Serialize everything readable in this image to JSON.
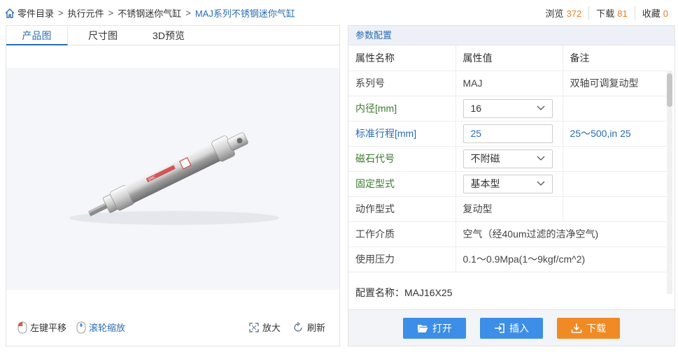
{
  "breadcrumb": {
    "items": [
      "零件目录",
      "执行元件",
      "不锈钢迷你气缸"
    ],
    "separator": ">",
    "current": "MAJ系列不锈钢迷你气缸"
  },
  "stats": [
    {
      "label": "浏览",
      "value": "372"
    },
    {
      "label": "下载",
      "value": "81"
    },
    {
      "label": "收藏",
      "value": "0"
    }
  ],
  "left": {
    "tabs": [
      "产品图",
      "尺寸图",
      "3D预览"
    ],
    "tools": {
      "pan": "左键平移",
      "zoom_wheel": "滚轮缩放",
      "enlarge": "放大",
      "refresh": "刷新"
    },
    "product_label": "SMC"
  },
  "right": {
    "header": "参数配置",
    "columns": [
      "属性名称",
      "属性值",
      "备注"
    ],
    "rows": [
      {
        "name": "系列号",
        "value": "MAJ",
        "note": "双轴可调复动型"
      },
      {
        "name": "内径[mm]",
        "value": "16",
        "note": ""
      },
      {
        "name": "标准行程[mm]",
        "value": "25",
        "note": "25～500,in 25"
      },
      {
        "name": "磁石代号",
        "value": "不附磁",
        "note": ""
      },
      {
        "name": "固定型式",
        "value": "基本型",
        "note": ""
      },
      {
        "name": "动作型式",
        "value": "复动型",
        "note": ""
      },
      {
        "name": "工作介质",
        "value": "空气（经40um过滤的洁净空气)",
        "note": ""
      },
      {
        "name": "使用压力",
        "value": "0.1～0.9Mpa(1～9kgf/cm^2)",
        "note": ""
      }
    ],
    "config_label": "配置名称：",
    "config_value": "MAJ16X25",
    "buttons": {
      "open": "打开",
      "insert": "插入",
      "download": "下载"
    }
  },
  "colors": {
    "accent": "#2b6cb0",
    "button_blue": "#3d8ee6",
    "button_orange": "#f08a24",
    "count_orange": "#e67e22"
  }
}
